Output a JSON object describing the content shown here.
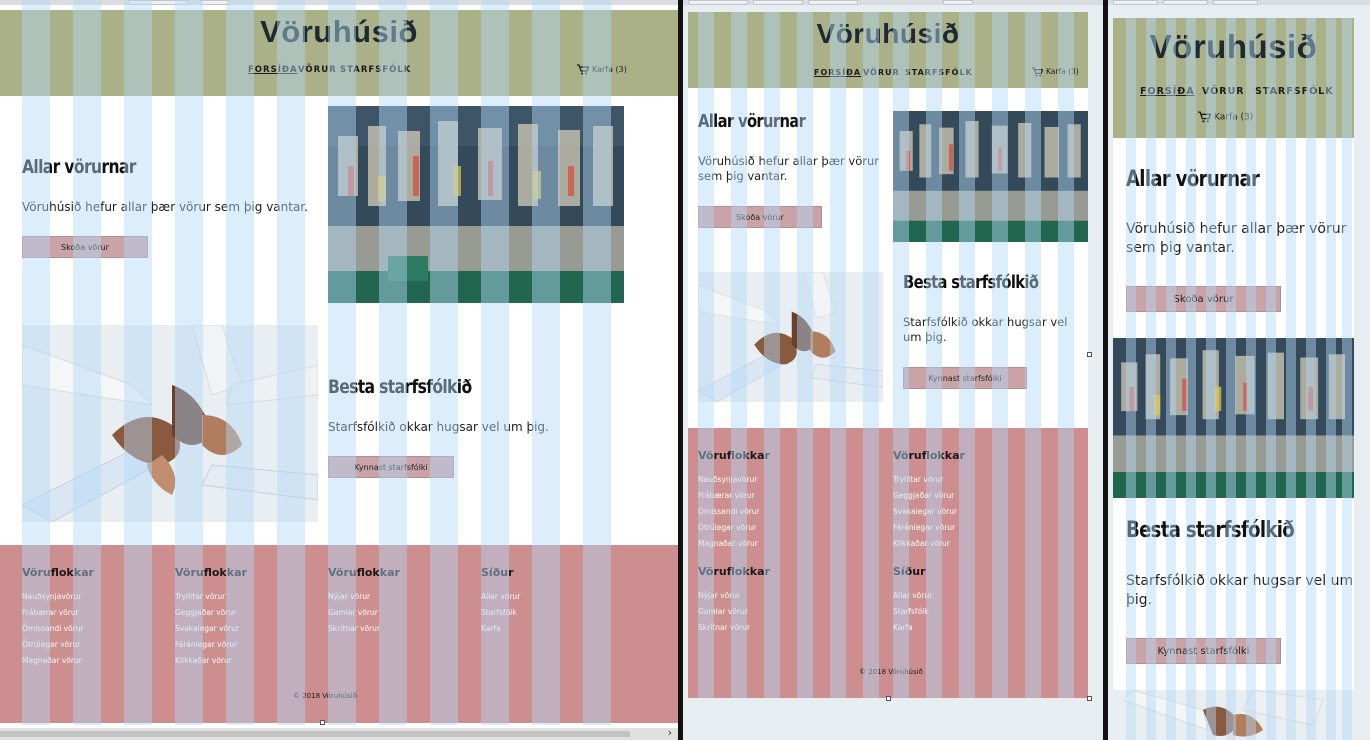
{
  "site": {
    "logo": "Vöruhúsið",
    "nav": [
      {
        "label": "FORSÍÐA",
        "active": true
      },
      {
        "label": "VÖRUR",
        "active": false
      },
      {
        "label": "STARFSFÓLK",
        "active": false
      }
    ],
    "cart_label": "Karfa (3)",
    "hero1": {
      "title": "Allar vörurnar",
      "text": "Vöruhúsið hefur allar þær vörur sem þig vantar.",
      "button": "Skoða vörur"
    },
    "hero2": {
      "title": "Besta starfsfólkið",
      "text_desktop": "Starfsfólkið okkar hugsar vel um þig.",
      "text_tablet": "Starfsfólkið okkar hugsar vel um þig.",
      "button": "Kynnast starfsfólki"
    },
    "footer": {
      "columns": [
        {
          "title": "Vöruflokkar",
          "links": [
            "Nauðsynjavörur",
            "Frábærar vörur",
            "Ómissandi vörur",
            "Ótrúlegar vörur",
            "Magnaðar vörur"
          ]
        },
        {
          "title": "Vöruflokkar",
          "links": [
            "Tryllitar vörur",
            "Geggjaðar vörur",
            "Svakalegar vörur",
            "Fáránlegar vörur",
            "Klikkaðar vörur"
          ]
        },
        {
          "title": "Vöruflokkar",
          "links": [
            "Nýjar vörur",
            "Gamlar vörur",
            "Skrítnar vörur"
          ]
        },
        {
          "title": "Síður",
          "links": [
            "Allar vörur",
            "Starfsfólk",
            "Karfa"
          ]
        }
      ],
      "copyright": "© 2018 Vöruhúsið"
    },
    "images": {
      "shop": "shop-shelves-image",
      "hands": "hands-teamwork-image"
    }
  },
  "colors": {
    "header_bg": "#aab088",
    "footer_bg": "#cd8e8f",
    "grid_overlay": "#b3d9f7",
    "button_bg": "#c9a3a8"
  }
}
